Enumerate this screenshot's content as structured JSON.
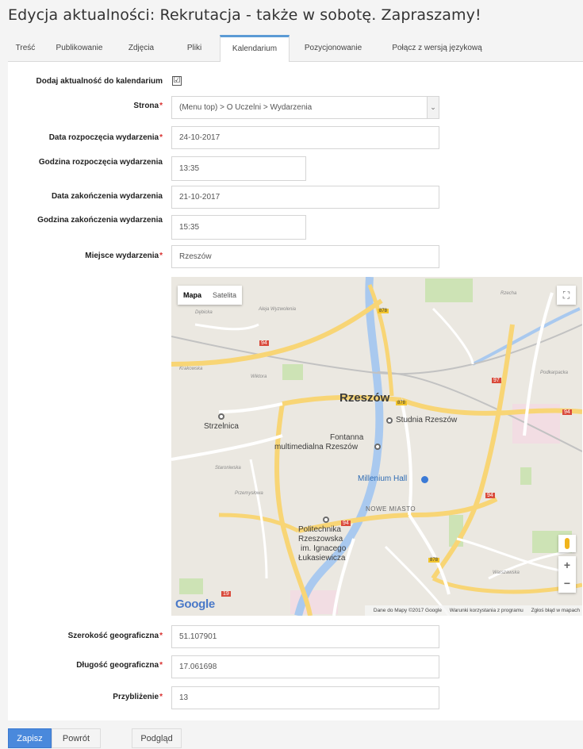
{
  "page": {
    "title": "Edycja aktualności: Rekrutacja - także w sobotę. Zapraszamy!"
  },
  "tabs": [
    {
      "label": "Treść"
    },
    {
      "label": "Publikowanie"
    },
    {
      "label": "Zdjęcia"
    },
    {
      "label": "Pliki"
    },
    {
      "label": "Kalendarium"
    },
    {
      "label": "Pozycjonowanie"
    },
    {
      "label": "Połącz z wersją językową"
    }
  ],
  "active_tab": "Kalendarium",
  "form": {
    "add_to_calendar": {
      "label": "Dodaj aktualność do kalendarium",
      "checked": true,
      "check_mark": "☑"
    },
    "required_mark": "*",
    "page": {
      "label": "Strona",
      "value": "(Menu top) > O Uczelni > Wydarzenia",
      "arrow": "⌄"
    },
    "start_date": {
      "label": "Data rozpoczęcia wydarzenia",
      "value": "24-10-2017"
    },
    "start_time": {
      "label": "Godzina rozpoczęcia wydarzenia",
      "value": "13:35"
    },
    "end_date": {
      "label": "Data zakończenia wydarzenia",
      "value": "21-10-2017"
    },
    "end_time": {
      "label": "Godzina zakończenia wydarzenia",
      "value": "15:35"
    },
    "place": {
      "label": "Miejsce wydarzenia",
      "value": "Rzeszów"
    },
    "latitude": {
      "label": "Szerokość geograficzna",
      "value": "51.107901"
    },
    "longitude": {
      "label": "Długość geograficzna",
      "value": "17.061698"
    },
    "zoom": {
      "label": "Przybliżenie",
      "value": "13"
    }
  },
  "map": {
    "type_map": "Mapa",
    "type_satellite": "Satelita",
    "fullscreen_icon": "⛶",
    "zoom_in": "+",
    "zoom_out": "−",
    "logo": "Google",
    "attribution": "Dane do Mapy ©2017 Google",
    "terms": "Warunki korzystania z programu",
    "report": "Zgłoś błąd w mapach",
    "labels": {
      "city": "Rzeszów",
      "poi_studnia": "Studnia Rzeszów",
      "poi_strzelnica": "Strzelnica",
      "poi_fontanna_1": "Fontanna",
      "poi_fontanna_2": "multimedialna Rzeszów",
      "poi_millenium": "Millenium Hall",
      "district": "NOWE MIASTO",
      "poi_polit_1": "Politechnika",
      "poi_polit_2": "Rzeszowska",
      "poi_polit_3": "im. Ignacego",
      "poi_polit_4": "Łukasiewicza",
      "street_debicka": "Dębicka",
      "street_wyzwolenia": "Aleja Wyzwolenia",
      "street_krakowska": "Krakowska",
      "street_wiktora": "Wiktora",
      "street_staroniwska": "Staroniwska",
      "street_podkarpacka": "Podkarpacka",
      "street_warszawska": "Warszawska",
      "street_przemyslowa": "Przemysłowa",
      "street_rzecha": "Rzecha",
      "road_94a": "94",
      "road_94b": "94",
      "road_94c": "94",
      "road_94d": "94",
      "road_97": "97",
      "road_19": "19",
      "road_878a": "878",
      "road_878b": "878",
      "road_878c": "878"
    }
  },
  "buttons": {
    "save": "Zapisz",
    "back": "Powrót",
    "preview": "Podgląd"
  }
}
